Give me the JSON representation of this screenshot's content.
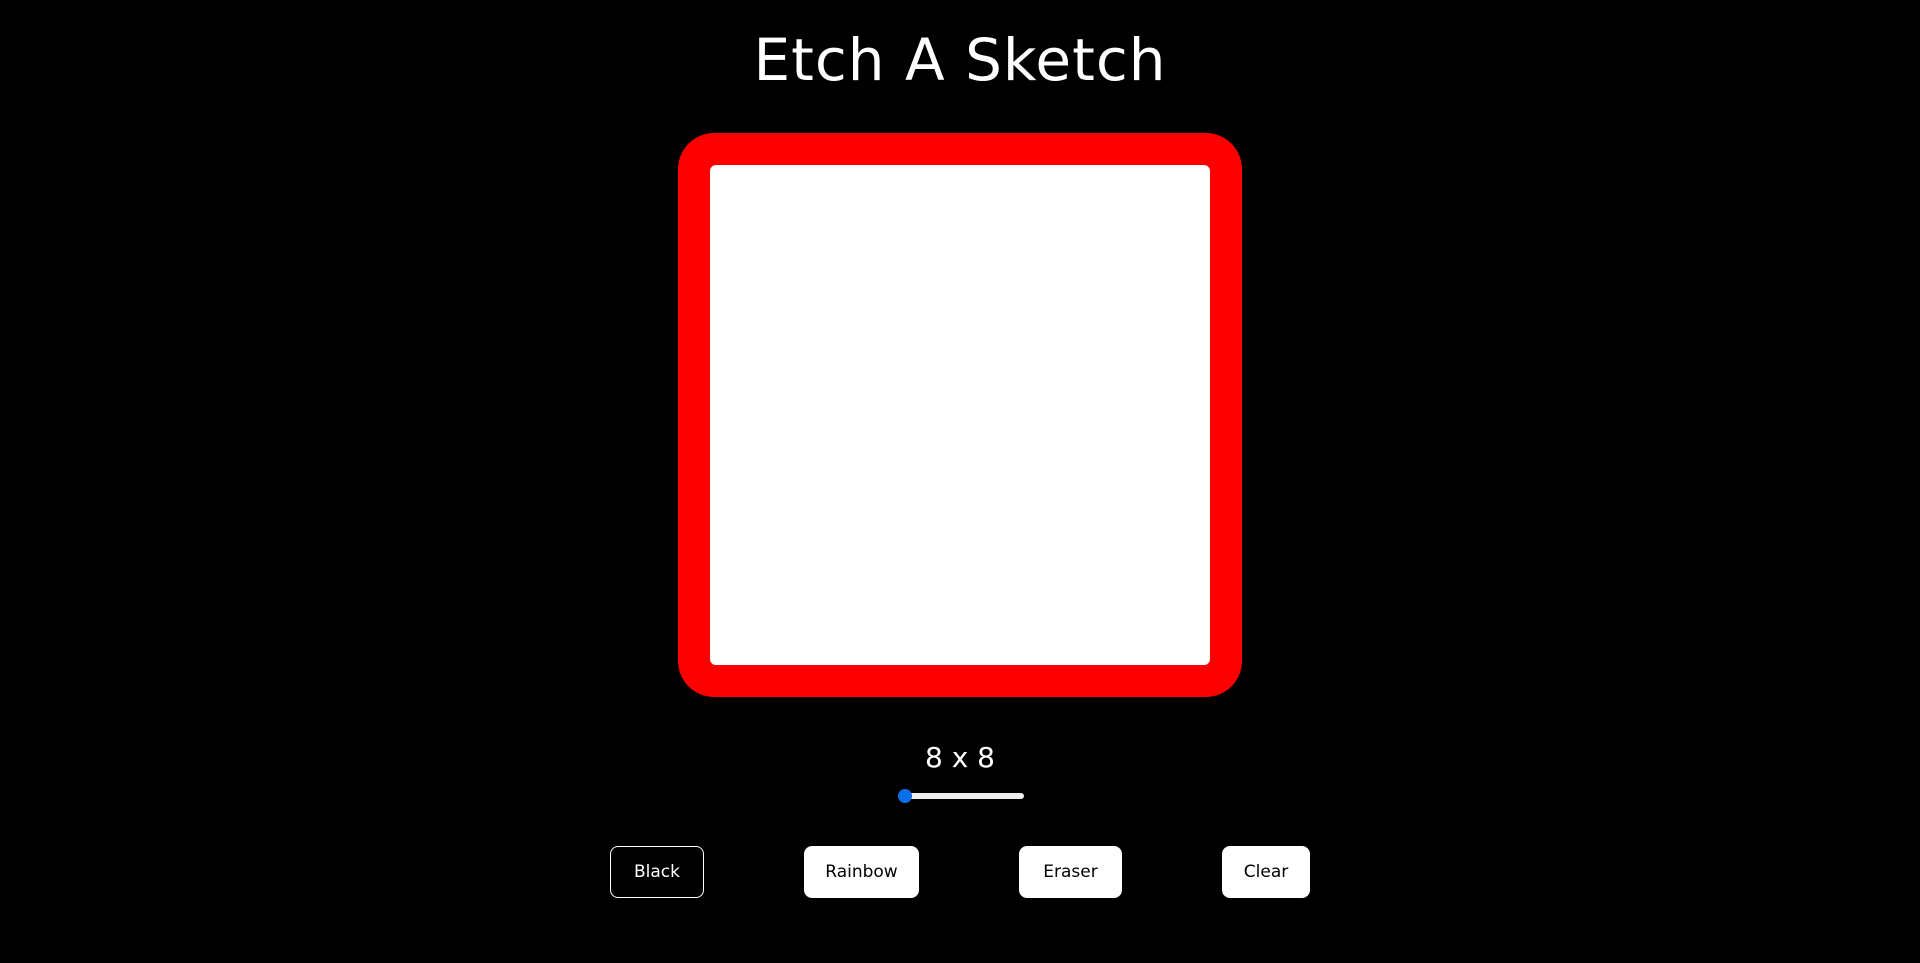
{
  "app": {
    "title": "Etch A Sketch"
  },
  "colors": {
    "background": "#000000",
    "frame": "#ff0000",
    "screen": "#ffffff",
    "slider_accent": "#0b6fe8"
  },
  "grid": {
    "size_label": "8 x 8",
    "slider_level": 0
  },
  "buttons": {
    "black": "Black",
    "rainbow": "Rainbow",
    "eraser": "Eraser",
    "clear": "Clear",
    "active": "black"
  }
}
